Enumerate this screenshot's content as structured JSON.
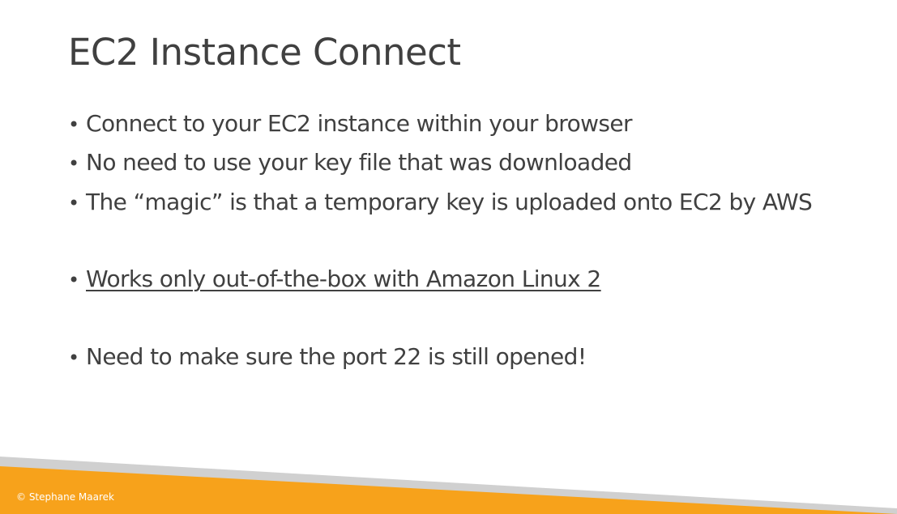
{
  "slide": {
    "title": "EC2 Instance Connect",
    "bullets": [
      {
        "marker": "•",
        "text": "Connect to your EC2 instance within your browser"
      },
      {
        "marker": "•",
        "text": "No need to use your key file that was downloaded"
      },
      {
        "marker": "•",
        "text": "The “magic” is that a temporary key is uploaded onto EC2 by AWS"
      },
      {
        "marker": "•",
        "text": "Works only out-of-the-box with Amazon Linux 2"
      },
      {
        "marker": "•",
        "text": "Need to make sure the port 22 is still opened!"
      }
    ],
    "footer": {
      "copyright": "© Stephane Maarek"
    }
  },
  "colors": {
    "text": "#404040",
    "accent_orange": "#F7A21B",
    "accent_gray": "#D0D0D0",
    "footer_text": "#FFFFFF"
  }
}
